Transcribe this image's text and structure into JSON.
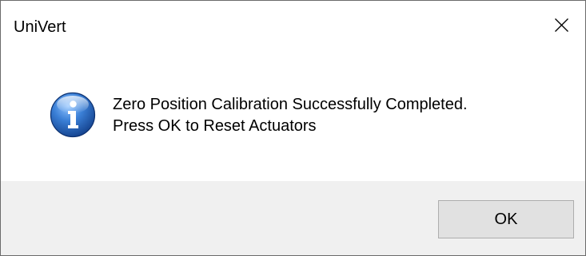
{
  "window": {
    "title": "UniVert",
    "close_icon": "close-icon"
  },
  "message": {
    "icon": "information-icon",
    "line1": "Zero Position Calibration Successfully Completed.",
    "line2": "Press OK to Reset Actuators"
  },
  "buttons": {
    "ok_label": "OK"
  },
  "colors": {
    "content_background": "#ffffff",
    "footer_background": "#f0f0f0",
    "button_face": "#e1e1e1",
    "button_border": "#adadad",
    "icon_blue": "#1f5fb5"
  }
}
